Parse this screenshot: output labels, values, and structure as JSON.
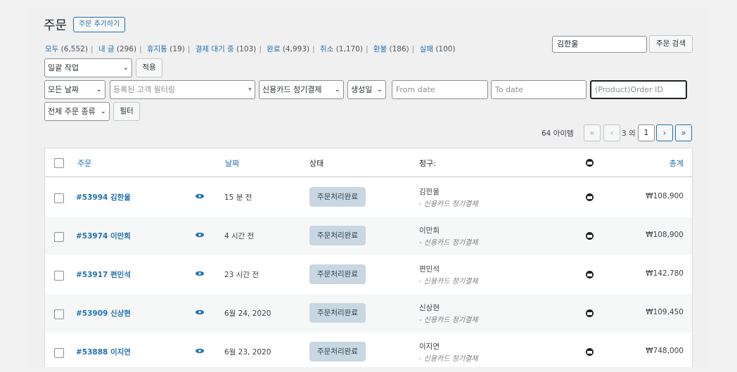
{
  "page": {
    "title": "주문",
    "add_button": "주문 추가하기"
  },
  "status_filters": [
    {
      "label": "모두",
      "count": "(6,552)"
    },
    {
      "label": "내 글",
      "count": "(296)"
    },
    {
      "label": "휴지통",
      "count": "(19)"
    },
    {
      "label": "결제 대기 중",
      "count": "(103)"
    },
    {
      "label": "완료",
      "count": "(4,993)"
    },
    {
      "label": "취소",
      "count": "(1,170)"
    },
    {
      "label": "환불",
      "count": "(186)"
    },
    {
      "label": "실패",
      "count": "(100)"
    }
  ],
  "search": {
    "value": "김한울",
    "button": "주문 검색"
  },
  "bulk": {
    "selected": "일괄 작업",
    "apply": "적용"
  },
  "filters": {
    "date": "모든 날짜",
    "customer_placeholder": "등록된 고객 필터링",
    "payment": "신용카드 정기결제",
    "sort": "생성일",
    "from_placeholder": "From date",
    "to_placeholder": "To date",
    "product_placeholder": "(Product)Order ID",
    "order_type": "전체 주문 종류",
    "filter_button": "필터"
  },
  "pagination": {
    "items": "64 아이템",
    "first": "«",
    "prev": "‹",
    "total_pages": "3 의",
    "current": "1",
    "next": "›",
    "last": "»"
  },
  "table": {
    "headers": {
      "order": "주문",
      "date": "날짜",
      "status": "상태",
      "billing": "청구:",
      "total": "총계"
    },
    "rows": [
      {
        "order": "#53994 김한울",
        "date": "15 분 전",
        "status": "주문처리완료",
        "name": "김한울",
        "method": "- 신용카드 정기결제",
        "total": "₩108,900"
      },
      {
        "order": "#53974 이만희",
        "date": "4 시간 전",
        "status": "주문처리완료",
        "name": "이만희",
        "method": "- 신용카드 정기결제",
        "total": "₩108,900"
      },
      {
        "order": "#53917 편민석",
        "date": "23 시간 전",
        "status": "주문처리완료",
        "name": "편민석",
        "method": "- 신용카드 정기결제",
        "total": "₩142,780"
      },
      {
        "order": "#53909 신상현",
        "date": "6월 24, 2020",
        "status": "주문처리완료",
        "name": "신상현",
        "method": "- 신용카드 정기결제",
        "total": "₩109,450"
      },
      {
        "order": "#53888 이지연",
        "date": "6월 23, 2020",
        "status": "주문처리완료",
        "name": "이지연",
        "method": "- 신용카드 정기결제",
        "total": "₩748,000"
      }
    ]
  },
  "colors": {
    "link": "#2271b1",
    "status_bg": "#c8d7e1",
    "status_text": "#2e4453"
  }
}
